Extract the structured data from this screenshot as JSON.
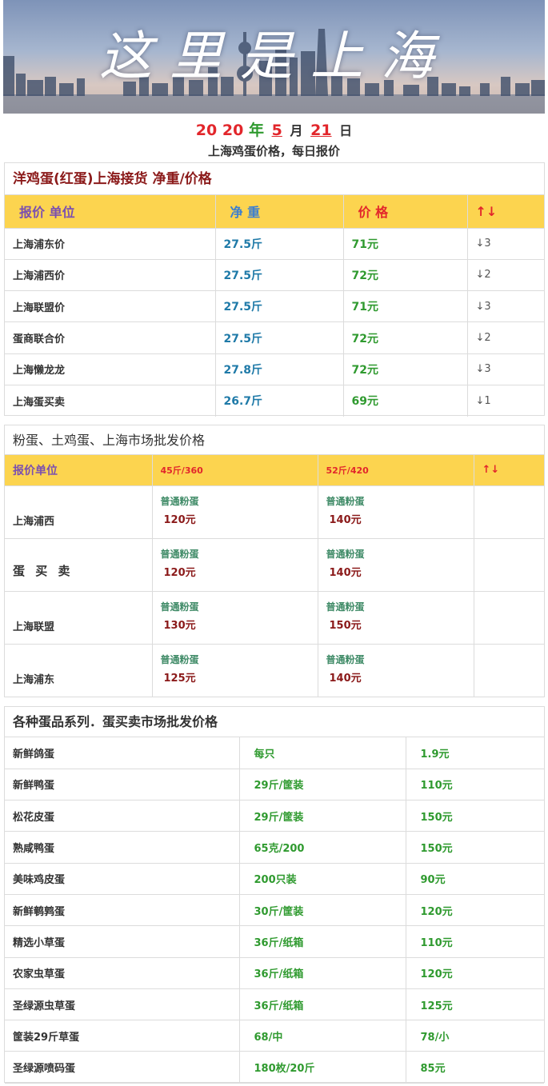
{
  "banner": {
    "title": "这里是上海"
  },
  "date": {
    "year_a": "20",
    "year_b": "20",
    "year_unit": "年",
    "month": "5",
    "month_unit": "月",
    "day": "21",
    "day_unit": "日"
  },
  "subtitle": "上海鸡蛋价格，每日报价",
  "section1": {
    "title": "洋鸡蛋(红蛋)上海接货 净重/价格",
    "headers": [
      "报价 单位",
      "净 重",
      "价 格",
      "↑↓"
    ],
    "rows": [
      {
        "name": "上海浦东价",
        "weight": "27.5斤",
        "price": "71元",
        "change": "↓3"
      },
      {
        "name": "上海浦西价",
        "weight": "27.5斤",
        "price": "72元",
        "change": "↓2"
      },
      {
        "name": "上海联盟价",
        "weight": "27.5斤",
        "price": "71元",
        "change": "↓3"
      },
      {
        "name": "蛋商联合价",
        "weight": "27.5斤",
        "price": "72元",
        "change": "↓2"
      },
      {
        "name": "上海懒龙龙",
        "weight": "27.8斤",
        "price": "72元",
        "change": "↓3"
      },
      {
        "name": "上海蛋买卖",
        "weight": "26.7斤",
        "price": "69元",
        "change": "↓1"
      }
    ]
  },
  "section2": {
    "title": "粉蛋、土鸡蛋、上海市场批发价格",
    "headers": [
      "报价单位",
      "45斤/360",
      "52斤/420",
      "↑↓"
    ],
    "rows": [
      {
        "name": "上海浦西",
        "kind_a": "普通粉蛋",
        "price_a": "120元",
        "kind_b": "普通粉蛋",
        "price_b": "140元"
      },
      {
        "name": "蛋 买 卖",
        "kind_a": "普通粉蛋",
        "price_a": "120元",
        "kind_b": "普通粉蛋",
        "price_b": "140元"
      },
      {
        "name": "上海联盟",
        "kind_a": "普通粉蛋",
        "price_a": "130元",
        "kind_b": "普通粉蛋",
        "price_b": "150元"
      },
      {
        "name": "上海浦东",
        "kind_a": "普通粉蛋",
        "price_a": "125元",
        "kind_b": "普通粉蛋",
        "price_b": "140元"
      }
    ]
  },
  "section3": {
    "title": "各种蛋品系列．蛋买卖市场批发价格",
    "rows": [
      {
        "name": "新鲜鸽蛋",
        "spec": "每只",
        "price": "1.9元"
      },
      {
        "name": "新鲜鸭蛋",
        "spec": "29斤/筐装",
        "price": "110元"
      },
      {
        "name": "松花皮蛋",
        "spec": "29斤/筐装",
        "price": "150元"
      },
      {
        "name": "熟咸鸭蛋",
        "spec": "65克/200",
        "price": "150元"
      },
      {
        "name": "美味鸡皮蛋",
        "spec": "200只装",
        "price": "90元"
      },
      {
        "name": "新鲜鹌鹑蛋",
        "spec": "30斤/筐装",
        "price": "120元"
      },
      {
        "name": "精选小草蛋",
        "spec": "36斤/纸箱",
        "price": "110元"
      },
      {
        "name": "农家虫草蛋",
        "spec": "36斤/纸箱",
        "price": "120元"
      },
      {
        "name": "圣绿源虫草蛋",
        "spec": "36斤/纸箱",
        "price": "125元"
      },
      {
        "name": "筐装29斤草蛋",
        "spec": "68/中",
        "price": "78/小"
      },
      {
        "name": "圣绿源喷码蛋",
        "spec": "180枚/20斤",
        "price": "85元"
      }
    ]
  }
}
